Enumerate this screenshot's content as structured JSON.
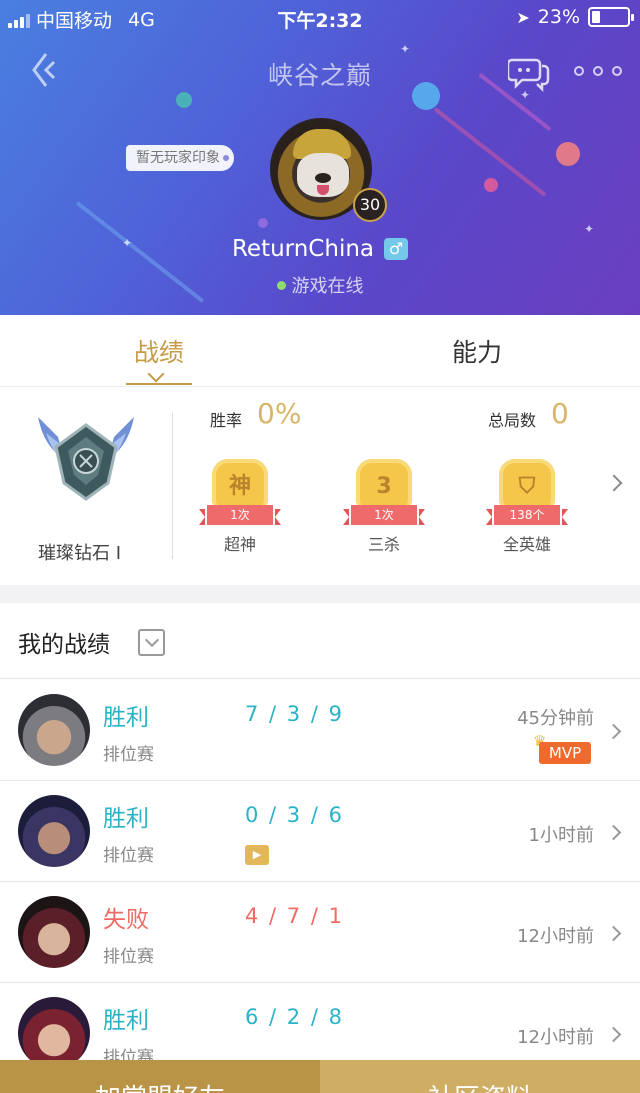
{
  "status_bar": {
    "carrier": "中国移动",
    "network": "4G",
    "time": "下午2:32",
    "battery": "23%",
    "battery_level": 0.23
  },
  "header": {
    "title": "峡谷之巅"
  },
  "profile": {
    "impression": "暂无玩家印象",
    "level": "30",
    "nickname": "ReturnChina",
    "gender_symbol": "♂",
    "status": "游戏在线"
  },
  "tabs": [
    {
      "label": "战绩"
    },
    {
      "label": "能力"
    }
  ],
  "stats": {
    "rank_name": "璀璨钻石 I",
    "win_rate_label": "胜率",
    "win_rate": "0%",
    "total_games_label": "总局数",
    "total_games": "0",
    "badges": [
      {
        "glyph": "神",
        "count": "1次",
        "label": "超神"
      },
      {
        "glyph": "3",
        "count": "1次",
        "label": "三杀"
      },
      {
        "glyph": "⛉",
        "count": "138个",
        "label": "全英雄"
      }
    ]
  },
  "matches_header": {
    "title": "我的战绩"
  },
  "matches": [
    {
      "result": "胜利",
      "mode": "排位赛",
      "kda": "7 / 3 / 9",
      "time": "45分钟前",
      "mvp": "MVP",
      "outcome": "win"
    },
    {
      "result": "胜利",
      "mode": "排位赛",
      "kda": "0 / 3 / 6",
      "time": "1小时前",
      "outcome": "win"
    },
    {
      "result": "失败",
      "mode": "排位赛",
      "kda": "4 / 7 / 1",
      "time": "12小时前",
      "outcome": "lose"
    },
    {
      "result": "胜利",
      "mode": "排位赛",
      "kda": "6 / 2 / 8",
      "time": "12小时前",
      "outcome": "win"
    }
  ],
  "bottom_bar": {
    "left_label": "加掌盟好友",
    "right_label": "社区资料"
  },
  "colors": {
    "accent_gold": "#c79b46",
    "win": "#2ab3c6",
    "lose": "#ee6b63",
    "mvp": "#ef6a2c"
  }
}
